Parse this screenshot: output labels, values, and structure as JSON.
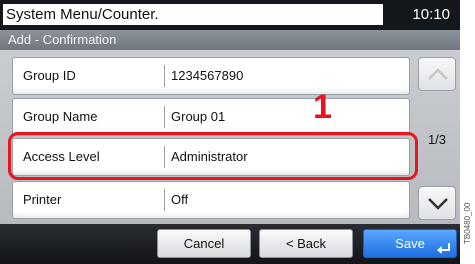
{
  "header": {
    "title": "System Menu/Counter.",
    "clock": "10:10",
    "subtitle": "Add - Confirmation"
  },
  "rows": [
    {
      "label": "Group ID",
      "value": "1234567890"
    },
    {
      "label": "Group Name",
      "value": "Group 01"
    },
    {
      "label": "Access Level",
      "value": "Administrator"
    },
    {
      "label": "Printer",
      "value": "Off"
    }
  ],
  "callout_number": "1",
  "pager": {
    "indicator": "1/3"
  },
  "footer": {
    "cancel_label": "Cancel",
    "back_label": "< Back",
    "save_label": "Save"
  },
  "document_id": "TB0480_00",
  "colors": {
    "highlight": "#e4161e",
    "save_button": "#2f86f0",
    "title_bar": "#14171b"
  },
  "icons": {
    "scroll_up": "chevron-up-icon",
    "scroll_down": "chevron-down-icon",
    "save": "enter-arrow-icon"
  }
}
